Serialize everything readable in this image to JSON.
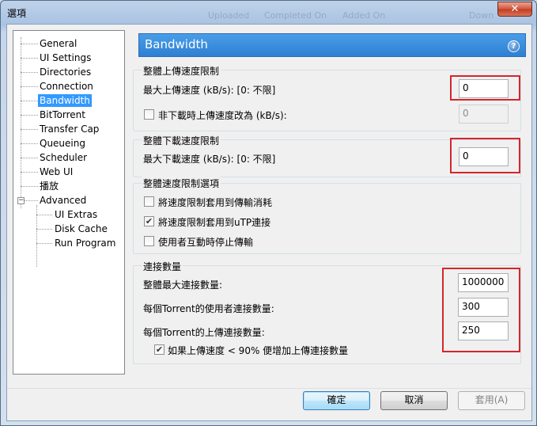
{
  "window": {
    "title": "選項",
    "bg_columns": [
      "Uploaded",
      "Completed On",
      "Added On",
      "Down"
    ],
    "close_glyph": "✕"
  },
  "tree": {
    "items": [
      {
        "label": "General"
      },
      {
        "label": "UI Settings"
      },
      {
        "label": "Directories"
      },
      {
        "label": "Connection"
      },
      {
        "label": "Bandwidth",
        "selected": true
      },
      {
        "label": "BitTorrent"
      },
      {
        "label": "Transfer Cap"
      },
      {
        "label": "Queueing"
      },
      {
        "label": "Scheduler"
      },
      {
        "label": "Web UI"
      },
      {
        "label": "播放"
      },
      {
        "label": "Advanced",
        "expander": "−"
      },
      {
        "label": "UI Extras"
      },
      {
        "label": "Disk Cache"
      },
      {
        "label": "Run Program"
      }
    ]
  },
  "panel": {
    "title": "Bandwidth",
    "help_glyph": "?",
    "upload_group": {
      "title": "整體上傳速度限制",
      "max_label": "最大上傳速度 (kB/s): [0: 不限]",
      "max_value": "0",
      "alt_checked": false,
      "alt_label": "非下載時上傳速度改為 (kB/s):",
      "alt_value": "0"
    },
    "download_group": {
      "title": "整體下載速度限制",
      "max_label": "最大下載速度 (kB/s): [0: 不限]",
      "max_value": "0"
    },
    "options_group": {
      "title": "整體速度限制選項",
      "options": [
        {
          "label": "將速度限制套用到傳輸消耗",
          "checked": false
        },
        {
          "label": "將速度限制套用到uTP連接",
          "checked": true
        },
        {
          "label": "使用者互動時停止傳輸",
          "checked": false
        }
      ]
    },
    "connections_group": {
      "title": "連接數量",
      "global_max_label": "整體最大連接數量:",
      "global_max_value": "1000000",
      "peers_label": "每個Torrent的使用者連接數量:",
      "peers_value": "300",
      "upload_slots_label": "每個Torrent的上傳連接數量:",
      "upload_slots_value": "250",
      "auto_slots_checked": true,
      "auto_slots_label": "如果上傳速度 < 90% 便增加上傳連接數量"
    }
  },
  "buttons": {
    "ok": "確定",
    "cancel": "取消",
    "apply": "套用(A)"
  },
  "colors": {
    "header_blue": "#2e7fd3",
    "selection": "#3399ff",
    "highlight_red": "#d5262e"
  }
}
